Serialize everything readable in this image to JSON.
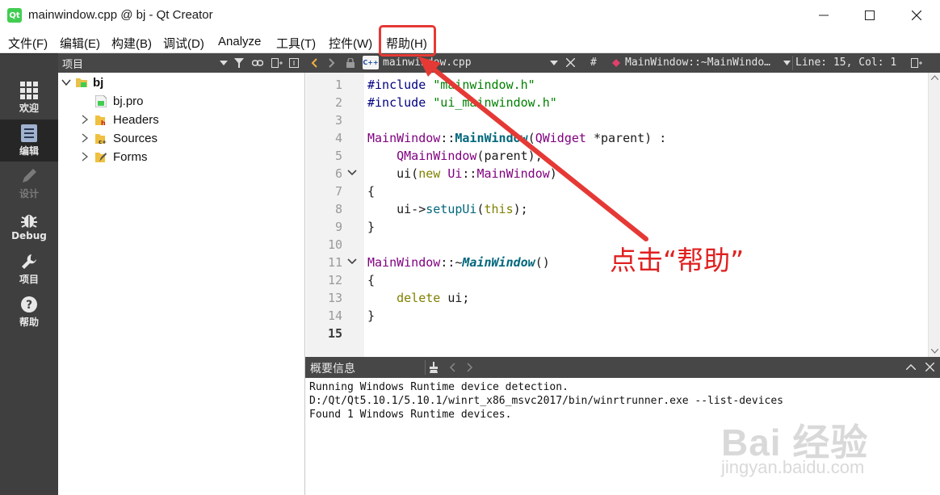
{
  "window": {
    "title": "mainwindow.cpp @ bj - Qt Creator",
    "app_icon_text": "Qt"
  },
  "menu": [
    "文件(F)",
    "编辑(E)",
    "构建(B)",
    "调试(D)",
    "Analyze",
    "工具(T)",
    "控件(W)",
    "帮助(H)"
  ],
  "modes": [
    {
      "label": "欢迎",
      "icon": "grid-icon"
    },
    {
      "label": "编辑",
      "icon": "document-icon"
    },
    {
      "label": "设计",
      "icon": "pencil-icon"
    },
    {
      "label": "Debug",
      "icon": "bug-icon"
    },
    {
      "label": "项目",
      "icon": "wrench-icon"
    },
    {
      "label": "帮助",
      "icon": "question-icon"
    }
  ],
  "project_pane": {
    "title": "项目",
    "tree": [
      {
        "label": "bj"
      },
      {
        "label": "bj.pro"
      },
      {
        "label": "Headers"
      },
      {
        "label": "Sources"
      },
      {
        "label": "Forms"
      }
    ]
  },
  "editor": {
    "file_badge": "C++",
    "file_name": "mainwindow.cpp",
    "hash": "#",
    "symbol": "MainWindow::~MainWindo…",
    "position": "Line: 15, Col: 1",
    "line_numbers": [
      "1",
      "2",
      "3",
      "4",
      "5",
      "6",
      "7",
      "8",
      "9",
      "10",
      "11",
      "12",
      "13",
      "14",
      "15"
    ],
    "code": {
      "l1_pp": "#include ",
      "l1_str": "\"mainwindow.h\"",
      "l2_pp": "#include ",
      "l2_str": "\"ui_mainwindow.h\"",
      "l4_a": "MainWindow",
      "l4_b": "::",
      "l4_c": "MainWindow",
      "l4_d": "(",
      "l4_e": "QWidget",
      "l4_f": " *parent) :",
      "l5_a": "    ",
      "l5_b": "QMainWindow",
      "l5_c": "(parent),",
      "l6_a": "    ui(",
      "l6_b": "new",
      "l6_c": " ",
      "l6_d": "Ui",
      "l6_e": "::",
      "l6_f": "MainWindow",
      "l6_g": ")",
      "l7": "{",
      "l8_a": "    ui->",
      "l8_b": "setupUi",
      "l8_c": "(",
      "l8_d": "this",
      "l8_e": ");",
      "l9": "}",
      "l11_a": "MainWindow",
      "l11_b": "::~",
      "l11_c": "MainWindow",
      "l11_d": "()",
      "l12": "{",
      "l13_a": "    ",
      "l13_b": "delete",
      "l13_c": " ui;",
      "l14": "}"
    }
  },
  "output": {
    "title": "概要信息",
    "lines": [
      "Running Windows Runtime device detection.",
      "D:/Qt/Qt5.10.1/5.10.1/winrt_x86_msvc2017/bin/winrtrunner.exe --list-devices",
      "Found 1 Windows Runtime devices."
    ]
  },
  "annotation": {
    "text": "点击“帮助”",
    "color": "#e02020"
  },
  "watermark": {
    "main": "Bai 经验",
    "sub": "jingyan.baidu.com"
  }
}
